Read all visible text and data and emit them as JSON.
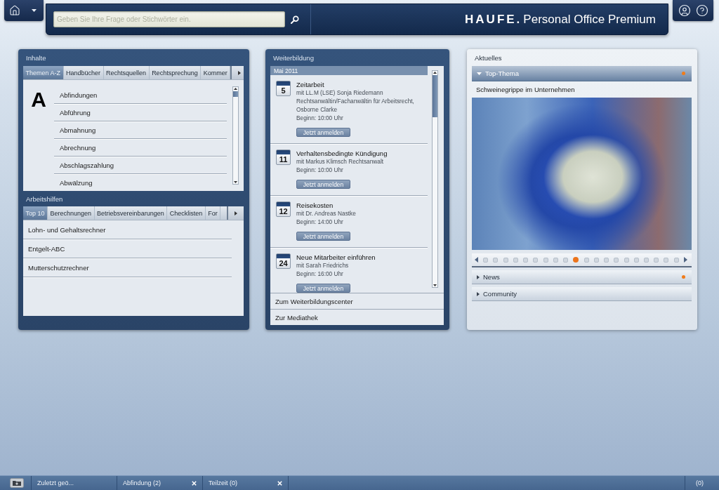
{
  "header": {
    "search": {
      "placeholder": "Geben Sie Ihre Frage oder Stichwörter ein."
    },
    "logo": {
      "brand": "HAUFE.",
      "product": "Personal Office Premium"
    }
  },
  "left_panel": {
    "sections": [
      {
        "kind": "index",
        "title": "Inhalte",
        "tabs": [
          {
            "label": "Themen A-Z",
            "selected": true
          },
          {
            "label": "Handbücher",
            "selected": false
          },
          {
            "label": "Rechtsquellen",
            "selected": false
          },
          {
            "label": "Rechtsprechung",
            "selected": false
          },
          {
            "label": "Kommer",
            "selected": false
          }
        ],
        "letter": "A",
        "items": [
          "Abfindungen",
          "Abführung",
          "Abmahnung",
          "Abrechnung",
          "Abschlagszahlung",
          "Abwälzung"
        ]
      },
      {
        "kind": "list",
        "title": "Arbeitshilfen",
        "tabs": [
          {
            "label": "Top 10",
            "selected": true
          },
          {
            "label": "Berechnungen",
            "selected": false
          },
          {
            "label": "Betriebsvereinbarungen",
            "selected": false
          },
          {
            "label": "Checklisten",
            "selected": false
          },
          {
            "label": "For",
            "selected": false
          }
        ],
        "items": [
          "Lohn- und Gehaltsrechner",
          "Entgelt-ABC",
          "Mutterschutzrechner"
        ]
      }
    ]
  },
  "training_panel": {
    "title": "Weiterbildung",
    "month": "Mai 2011",
    "events": [
      {
        "day": "5",
        "title": "Zeitarbeit",
        "speaker": "mit LL.M (LSE) Sonja Riedemann Rechtsanwältin/Fachanwältin für Arbeitsrecht, Osborne Clarke",
        "start": "Beginn: 10:00 Uhr",
        "button": "Jetzt anmelden"
      },
      {
        "day": "11",
        "title": "Verhaltensbedingte Kündigung",
        "speaker": "mit Markus Klimsch Rechtsanwalt",
        "start": "Beginn: 10:00 Uhr",
        "button": "Jetzt anmelden"
      },
      {
        "day": "12",
        "title": "Reisekosten",
        "speaker": "mit Dr. Andreas Nastke",
        "start": "Beginn: 14:00 Uhr",
        "button": "Jetzt anmelden"
      },
      {
        "day": "24",
        "title": "Neue Mitarbeiter einführen",
        "speaker": "mit Sarah Friedrichs",
        "start": "Beginn: 16:00 Uhr",
        "button": "Jetzt anmelden"
      }
    ],
    "links": [
      "Zum Weiterbildungscenter",
      "Zur Mediathek"
    ]
  },
  "news_panel": {
    "title": "Aktuelles",
    "sections": [
      {
        "label": "Top-Thema",
        "expanded": true,
        "has_new": true,
        "headline": "Schweinegrippe im Unternehmen",
        "slides": [
          {
            "selected": false
          },
          {
            "selected": false
          },
          {
            "selected": false
          },
          {
            "selected": false
          },
          {
            "selected": false
          },
          {
            "selected": false
          },
          {
            "selected": false
          },
          {
            "selected": false
          },
          {
            "selected": false
          },
          {
            "selected": true
          },
          {
            "selected": false
          },
          {
            "selected": false
          },
          {
            "selected": false
          },
          {
            "selected": false
          },
          {
            "selected": false
          },
          {
            "selected": false
          },
          {
            "selected": false
          },
          {
            "selected": false
          },
          {
            "selected": false
          },
          {
            "selected": false
          }
        ]
      },
      {
        "label": "News",
        "expanded": false,
        "has_new": true
      },
      {
        "label": "Community",
        "expanded": false,
        "has_new": false
      }
    ]
  },
  "taskbar": {
    "tabs": [
      {
        "label": "Zuletzt geö...",
        "closable": false
      },
      {
        "label": "Abfindung (2)",
        "closable": true
      },
      {
        "label": "Teilzeit (0)",
        "closable": true
      }
    ],
    "counter": "(0)"
  }
}
